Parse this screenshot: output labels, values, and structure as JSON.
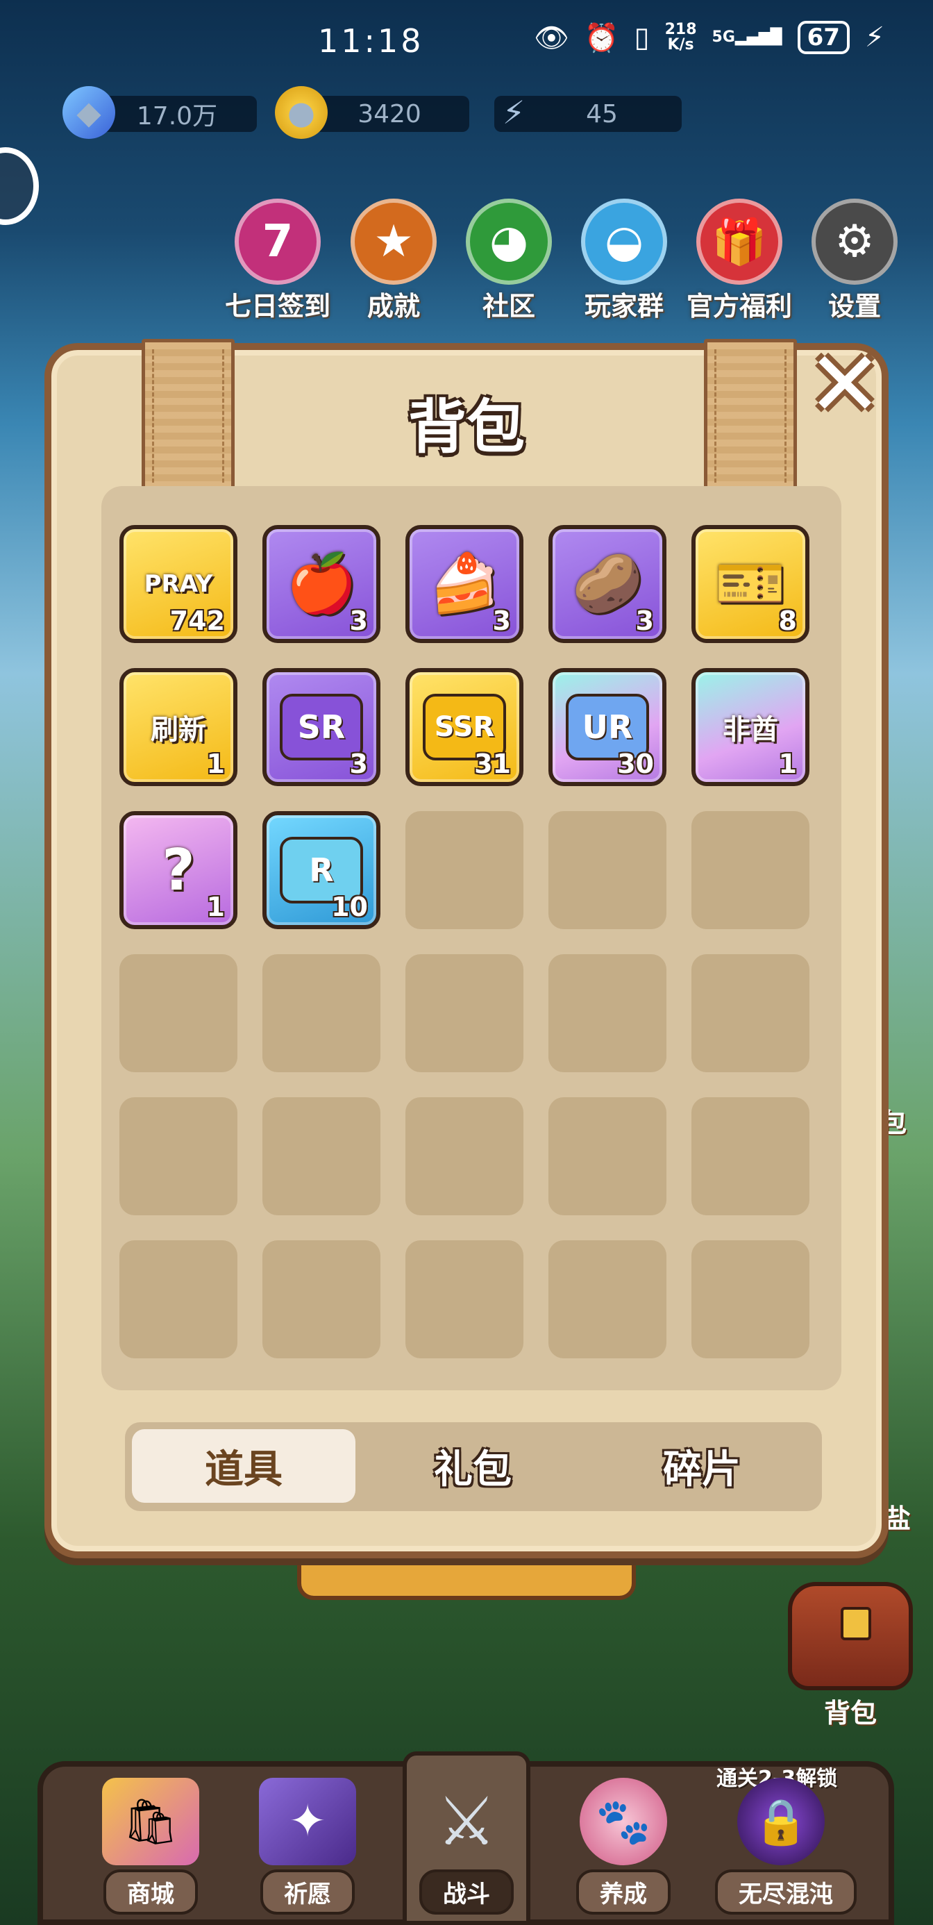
{
  "status_bar": {
    "time": "11:18",
    "net_speed_value": "218",
    "net_speed_unit": "K/s",
    "network": "5G",
    "battery": "67"
  },
  "resources": [
    {
      "icon": "gem-icon",
      "value": "17.0万"
    },
    {
      "icon": "coin-icon",
      "value": "3420"
    },
    {
      "icon": "energy-icon",
      "value": "45"
    }
  ],
  "top_menu": [
    {
      "label": "七日签到",
      "glyph": "7",
      "color": "#c2307a"
    },
    {
      "label": "成就",
      "glyph": "★",
      "color": "#d36a1e"
    },
    {
      "label": "社区",
      "glyph": "◕",
      "color": "#2f9a3a"
    },
    {
      "label": "玩家群",
      "glyph": "◒",
      "color": "#3aa4e0"
    },
    {
      "label": "官方福利",
      "glyph": "🎁",
      "color": "#d6333a"
    },
    {
      "label": "设置",
      "glyph": "⚙",
      "color": "#4a4a4a"
    }
  ],
  "dialog": {
    "title": "背包",
    "close_glyph": "✕"
  },
  "items": [
    {
      "name": "pray-ticket",
      "glyph": "PRAY",
      "count": "742",
      "rarity": "gold"
    },
    {
      "name": "apple",
      "glyph": "🍎",
      "count": "3",
      "rarity": "purple"
    },
    {
      "name": "cake",
      "glyph": "🍰",
      "count": "3",
      "rarity": "purple"
    },
    {
      "name": "chips",
      "glyph": "🥔",
      "count": "3",
      "rarity": "purple"
    },
    {
      "name": "pink-ticket",
      "glyph": "🎫",
      "count": "8",
      "rarity": "gold"
    },
    {
      "name": "refresh-ticket",
      "glyph": "刷新",
      "count": "1",
      "rarity": "gold"
    },
    {
      "name": "sr-fragment",
      "glyph": "SR",
      "count": "3",
      "rarity": "purple",
      "puzzle": "#8752d8"
    },
    {
      "name": "ssr-fragment",
      "glyph": "SSR",
      "count": "31",
      "rarity": "gold",
      "puzzle": "#f4b916"
    },
    {
      "name": "ur-fragment",
      "glyph": "UR",
      "count": "30",
      "rarity": "holo",
      "puzzle": "#6fa6f0"
    },
    {
      "name": "fei-qiu-card",
      "glyph": "非酋",
      "count": "1",
      "rarity": "holo"
    },
    {
      "name": "mystery-bag",
      "glyph": "?",
      "count": "1",
      "rarity": "pink"
    },
    {
      "name": "r-fragment",
      "glyph": "R",
      "count": "10",
      "rarity": "cyan",
      "puzzle": "#6fd0ef"
    }
  ],
  "tabs": [
    {
      "label": "道具",
      "active": true
    },
    {
      "label": "礼包",
      "active": false
    },
    {
      "label": "碎片",
      "active": false
    }
  ],
  "side": {
    "backpack_label": "背包",
    "peek_label_1": "包",
    "peek_label_2": "盐"
  },
  "bottom_nav": [
    {
      "label": "商城",
      "glyph": "🛍"
    },
    {
      "label": "祈愿",
      "glyph": "✦"
    },
    {
      "label": "战斗",
      "glyph": "⚔"
    },
    {
      "label": "养成",
      "glyph": "🐾"
    },
    {
      "label": "无尽混沌",
      "glyph": "🔒"
    }
  ],
  "unlock_tip": "通关2-3解锁"
}
